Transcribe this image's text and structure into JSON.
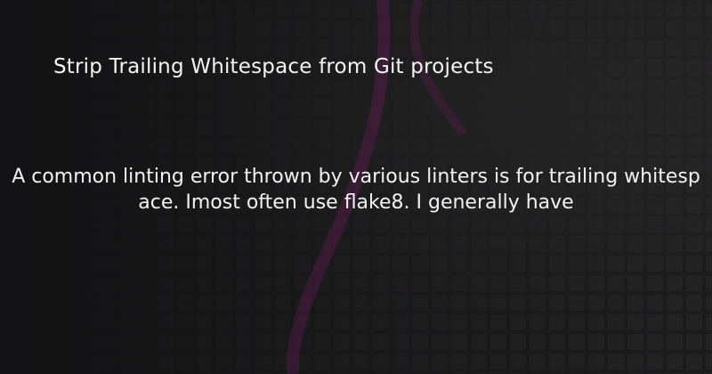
{
  "post": {
    "title": "Strip Trailing Whitespace from Git projects",
    "excerpt": "A common linting error thrown by various linters is for trailing whitespace.  Imost often use flake8.  I generally have"
  },
  "colors": {
    "background": "#1d1c1d",
    "grid_tile": "#2a292a",
    "accent_glow": "#8e1f78",
    "text": "#f2f2f2"
  }
}
